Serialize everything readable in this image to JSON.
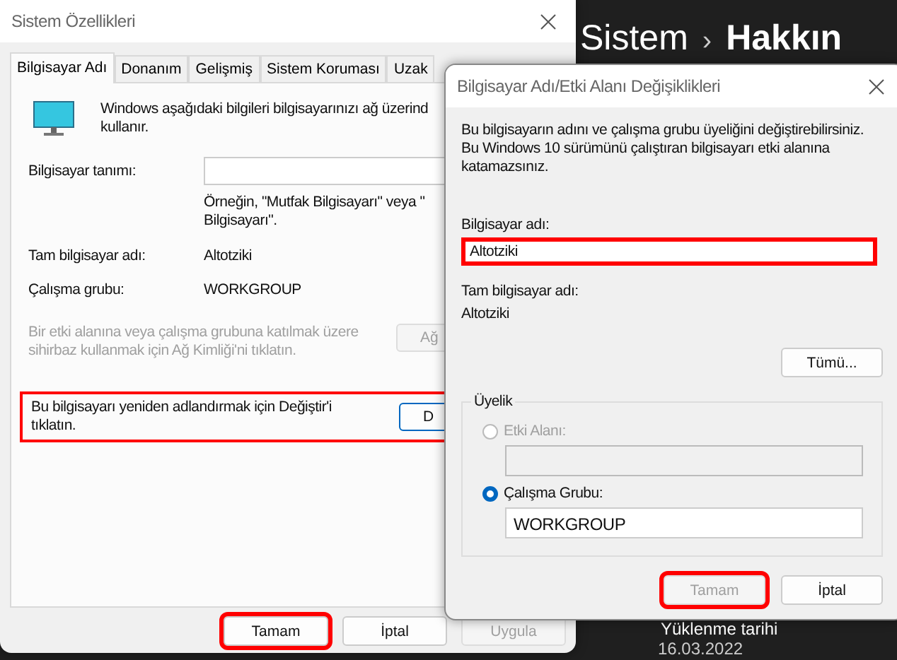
{
  "background": {
    "breadcrumb": [
      "Sistem",
      "›",
      "Hakkın"
    ],
    "install_label": "Yüklenme tarihi",
    "install_date": "16.03.2022"
  },
  "system_properties": {
    "title": "Sistem Özellikleri",
    "tabs": [
      {
        "label": "Bilgisayar Adı",
        "selected": true
      },
      {
        "label": "Donanım",
        "selected": false
      },
      {
        "label": "Gelişmiş",
        "selected": false
      },
      {
        "label": "Sistem Koruması",
        "selected": false
      },
      {
        "label": "Uzak",
        "selected": false
      }
    ],
    "intro": "Windows aşağıdaki bilgileri bilgisayarınızı ağ üzerind\nkullanır.",
    "description_label": "Bilgisayar tanımı:",
    "example": "Örneğin, \"Mutfak Bilgisayarı\" veya \"\nBilgisayarı\".",
    "full_name_label": "Tam bilgisayar adı:",
    "full_name": "Altotziki",
    "workgroup_label": "Çalışma grubu:",
    "workgroup": "WORKGROUP",
    "network_id": {
      "text": "Bir etki alanına veya çalışma grubuna katılmak üzere\nsihirbaz kullanmak için Ağ Kimliği'ni tıklatın.",
      "button": "Ağ",
      "disabled": true
    },
    "rename": {
      "text": "Bu bilgisayarı yeniden adlandırmak için Değiştir'i\ntıklatın.",
      "button": "D",
      "highlighted": true
    },
    "buttons": [
      {
        "label": "Tamam",
        "disabled": false,
        "highlighted": true
      },
      {
        "label": "İptal",
        "disabled": false,
        "highlighted": false
      },
      {
        "label": "Uygula",
        "disabled": true,
        "highlighted": false
      }
    ]
  },
  "name_dialog": {
    "title": "Bilgisayar Adı/Etki Alanı Değişiklikleri",
    "intro": "Bu bilgisayarın adını ve çalışma grubu üyeliğini değiştirebilirsiniz.\nBu Windows 10 sürümünü çalıştıran bilgisayarı etki alanına\nkatamazsınız.",
    "name_label": "Bilgisayar adı:",
    "name_value": "Altotziki",
    "name_highlighted": true,
    "full_name_label": "Tam bilgisayar adı:",
    "full_name": "Altotziki",
    "more_button": "Tümü...",
    "membership": {
      "legend": "Üyelik",
      "options": [
        {
          "label": "Etki Alanı:",
          "selected": false,
          "disabled": true
        },
        {
          "label": "Çalışma Grubu:",
          "selected": true,
          "disabled": false,
          "value": "WORKGROUP"
        }
      ]
    },
    "buttons": [
      {
        "label": "Tamam",
        "disabled": true,
        "highlighted": true
      },
      {
        "label": "İptal",
        "disabled": false,
        "highlighted": false
      }
    ]
  }
}
